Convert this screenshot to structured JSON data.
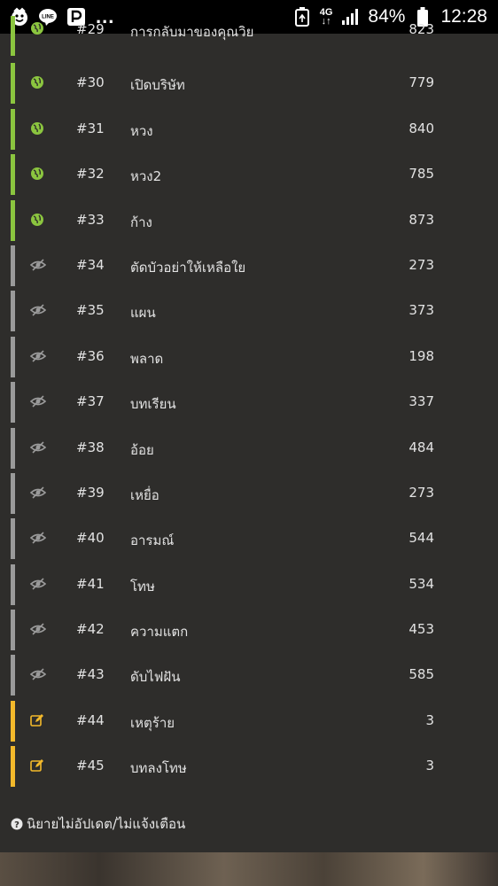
{
  "status_bar": {
    "overflow": "...",
    "network_top": "4G",
    "network_bottom": "↓↑",
    "battery": "84%",
    "time": "12:28"
  },
  "colors": {
    "published": "#8bc53f",
    "hidden": "#9a9a9a",
    "draft": "#f3b92b"
  },
  "chapters": [
    {
      "num": "#29",
      "title": "การกลับมาของคุณวิย",
      "count": "823",
      "status": "published",
      "icon": "globe-icon"
    },
    {
      "num": "#30",
      "title": "เปิดบริษัท",
      "count": "779",
      "status": "published",
      "icon": "globe-icon"
    },
    {
      "num": "#31",
      "title": "หวง",
      "count": "840",
      "status": "published",
      "icon": "globe-icon"
    },
    {
      "num": "#32",
      "title": "หวง2",
      "count": "785",
      "status": "published",
      "icon": "globe-icon"
    },
    {
      "num": "#33",
      "title": "ก้าง",
      "count": "873",
      "status": "published",
      "icon": "globe-icon"
    },
    {
      "num": "#34",
      "title": "ตัดบัวอย่าให้เหลือใย",
      "count": "273",
      "status": "hidden",
      "icon": "eye-slash-icon"
    },
    {
      "num": "#35",
      "title": "แผน",
      "count": "373",
      "status": "hidden",
      "icon": "eye-slash-icon"
    },
    {
      "num": "#36",
      "title": "พลาด",
      "count": "198",
      "status": "hidden",
      "icon": "eye-slash-icon"
    },
    {
      "num": "#37",
      "title": "บทเรียน",
      "count": "337",
      "status": "hidden",
      "icon": "eye-slash-icon"
    },
    {
      "num": "#38",
      "title": "อ้อย",
      "count": "484",
      "status": "hidden",
      "icon": "eye-slash-icon"
    },
    {
      "num": "#39",
      "title": "เหยื่อ",
      "count": "273",
      "status": "hidden",
      "icon": "eye-slash-icon"
    },
    {
      "num": "#40",
      "title": "อารมณ์",
      "count": "544",
      "status": "hidden",
      "icon": "eye-slash-icon"
    },
    {
      "num": "#41",
      "title": "โทษ",
      "count": "534",
      "status": "hidden",
      "icon": "eye-slash-icon"
    },
    {
      "num": "#42",
      "title": "ความแตก",
      "count": "453",
      "status": "hidden",
      "icon": "eye-slash-icon"
    },
    {
      "num": "#43",
      "title": "ดับไฟฝัน",
      "count": "585",
      "status": "hidden",
      "icon": "eye-slash-icon"
    },
    {
      "num": "#44",
      "title": "เหตุร้าย",
      "count": "3",
      "status": "draft",
      "icon": "edit-icon"
    },
    {
      "num": "#45",
      "title": "บทลงโทษ",
      "count": "3",
      "status": "draft",
      "icon": "edit-icon"
    }
  ],
  "footer_note": "นิยายไม่อัปเดต/ไม่แจ้งเตือน",
  "footer_icon": "question-circle-icon"
}
